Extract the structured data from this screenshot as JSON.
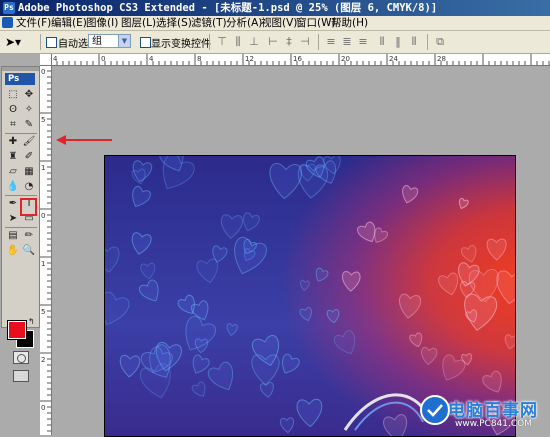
{
  "window": {
    "title": "Adobe Photoshop CS3 Extended - [未标题-1.psd @ 25% (图层 6, CMYK/8)]"
  },
  "menu": [
    {
      "label": "文件(F)"
    },
    {
      "label": "编辑(E)"
    },
    {
      "label": "图像(I)"
    },
    {
      "label": "图层(L)"
    },
    {
      "label": "选择(S)"
    },
    {
      "label": "滤镜(T)"
    },
    {
      "label": "分析(A)"
    },
    {
      "label": "视图(V)"
    },
    {
      "label": "窗口(W)"
    },
    {
      "label": "帮助(H)"
    }
  ],
  "options": {
    "auto_select_label": "自动选择:",
    "auto_select_value": "组",
    "show_transform_label": "显示变换控件"
  },
  "toolbox": {
    "logo": "Ps",
    "foreground_color": "#e8101d",
    "background_color": "#000000",
    "highlighted_tool": "brush"
  },
  "rulers": {
    "top_ticks": [
      "4",
      "0",
      "4",
      "8",
      "12",
      "16",
      "20",
      "24",
      "28"
    ],
    "left_ticks": [
      "0",
      "5",
      "1",
      "0",
      "1",
      "5",
      "2",
      "0"
    ]
  },
  "watermark": {
    "logo_text": "电脑百事网",
    "url": "www.PC841.COM"
  }
}
